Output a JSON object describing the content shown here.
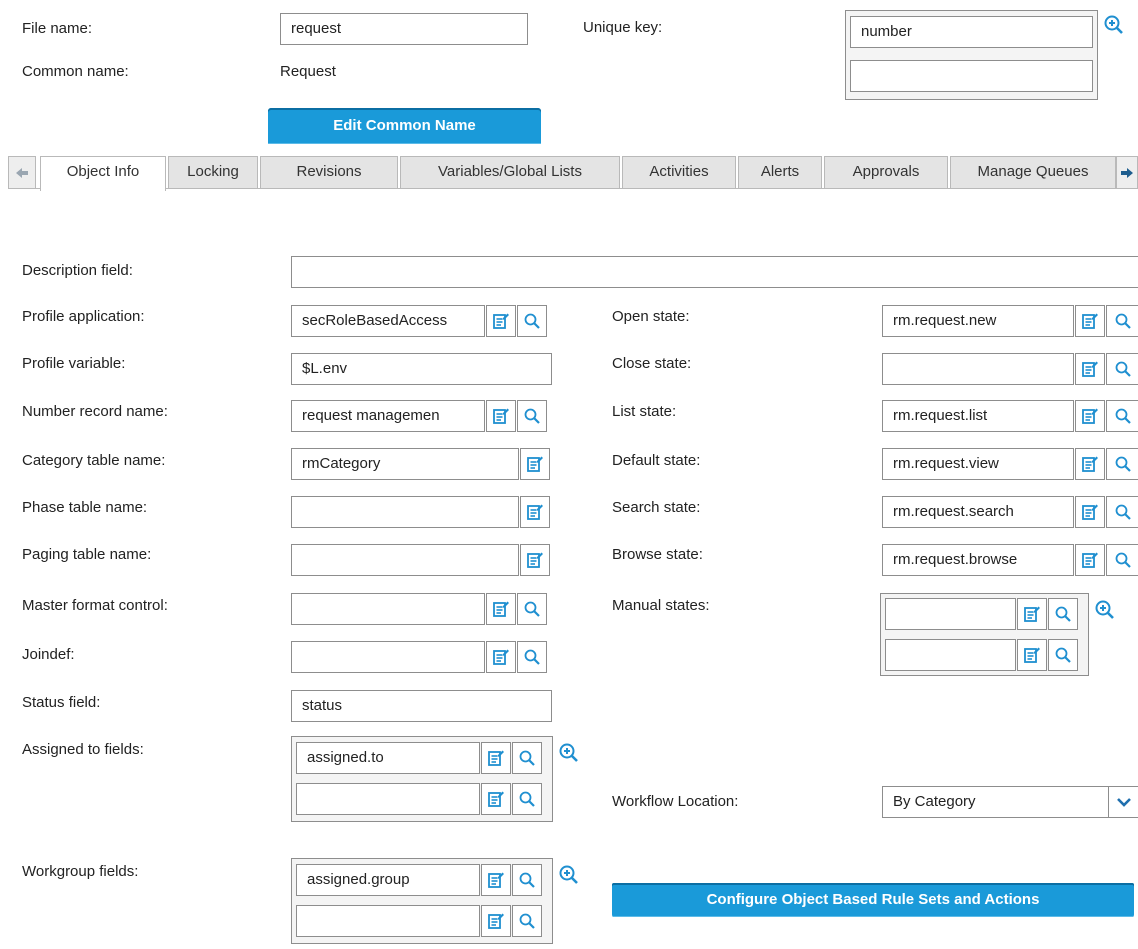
{
  "header": {
    "file_name_label": "File name:",
    "file_name_value": "request",
    "common_name_label": "Common name:",
    "common_name_value": "Request",
    "unique_key_label": "Unique key:",
    "unique_key_values": [
      "number",
      ""
    ],
    "edit_common_name_button": "Edit Common Name"
  },
  "tabs": [
    {
      "label": "Object Info",
      "active": true
    },
    {
      "label": "Locking"
    },
    {
      "label": "Revisions"
    },
    {
      "label": "Variables/Global Lists"
    },
    {
      "label": "Activities"
    },
    {
      "label": "Alerts"
    },
    {
      "label": "Approvals"
    },
    {
      "label": "Manage Queues"
    }
  ],
  "left_fields": {
    "description_field": {
      "label": "Description field:",
      "value": ""
    },
    "profile_application": {
      "label": "Profile application:",
      "value": "secRoleBasedAccess"
    },
    "profile_variable": {
      "label": "Profile variable:",
      "value": "$L.env"
    },
    "number_record_name": {
      "label": "Number record name:",
      "value": "request managemen"
    },
    "category_table_name": {
      "label": "Category table name:",
      "value": "rmCategory"
    },
    "phase_table_name": {
      "label": "Phase table name:",
      "value": ""
    },
    "paging_table_name": {
      "label": "Paging table name:",
      "value": ""
    },
    "master_format_control": {
      "label": "Master format control:",
      "value": ""
    },
    "joindef": {
      "label": "Joindef:",
      "value": ""
    },
    "status_field": {
      "label": "Status field:",
      "value": "status"
    },
    "assigned_to_fields": {
      "label": "Assigned to fields:",
      "values": [
        "assigned.to",
        ""
      ]
    },
    "workgroup_fields": {
      "label": "Workgroup fields:",
      "values": [
        "assigned.group",
        ""
      ]
    }
  },
  "right_fields": {
    "open_state": {
      "label": "Open state:",
      "value": "rm.request.new"
    },
    "close_state": {
      "label": "Close state:",
      "value": ""
    },
    "list_state": {
      "label": "List state:",
      "value": "rm.request.list"
    },
    "default_state": {
      "label": "Default state:",
      "value": "rm.request.view"
    },
    "search_state": {
      "label": "Search state:",
      "value": "rm.request.search"
    },
    "browse_state": {
      "label": "Browse state:",
      "value": "rm.request.browse"
    },
    "manual_states": {
      "label": "Manual states:",
      "values": [
        "",
        ""
      ]
    },
    "workflow_location": {
      "label": "Workflow Location:",
      "value": "By Category"
    }
  },
  "configure_button": "Configure Object Based Rule Sets and Actions",
  "icons": {
    "form_icon": "form-edit-icon",
    "search_icon": "magnifier-icon",
    "zoom_add_icon": "zoom-plus-icon",
    "dropdown_icon": "chevron-down-icon",
    "tab_left": "arrow-left-icon",
    "tab_right": "arrow-right-icon"
  },
  "colors": {
    "accent": "#1a9ad9",
    "icon_blue": "#1f8fd0"
  }
}
